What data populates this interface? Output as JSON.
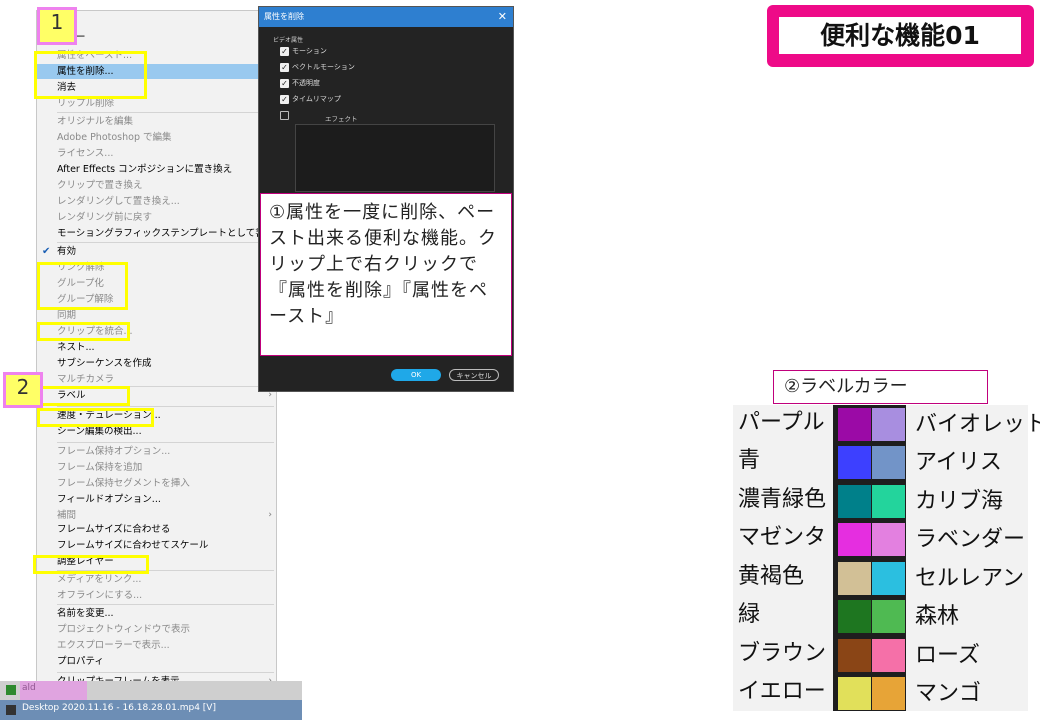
{
  "badges": {
    "one": "1",
    "two": "2"
  },
  "menu": {
    "items": [
      {
        "label": "コピー",
        "state": "normal",
        "top": 0
      },
      {
        "label": "属性をペースト...",
        "state": "dis",
        "top": 0
      },
      {
        "label": "属性を削除...",
        "state": "hl",
        "top": 0
      },
      {
        "label": "消去",
        "state": "normal",
        "top": 0
      },
      {
        "label": "リップル削除",
        "state": "dis",
        "top": 0
      },
      {
        "label": "オリジナルを編集",
        "state": "dis",
        "top": 0
      },
      {
        "label": "Adobe Photoshop で編集",
        "state": "dis",
        "top": 0
      },
      {
        "label": "ライセンス...",
        "state": "dis",
        "top": 0
      },
      {
        "label": "After Effects コンポジションに置き換え",
        "state": "normal",
        "top": 0
      },
      {
        "label": "クリップで置き換え",
        "state": "dis",
        "top": 0
      },
      {
        "label": "レンダリングして置き換え...",
        "state": "dis",
        "top": 0
      },
      {
        "label": "レンダリング前に戻す",
        "state": "dis",
        "top": 0
      },
      {
        "label": "モーショングラフィックステンプレートとして書き出し...",
        "state": "normal",
        "top": 0
      },
      {
        "label": "有効",
        "state": "check",
        "top": 0
      },
      {
        "label": "リンク解除",
        "state": "dis",
        "top": 0
      },
      {
        "label": "グループ化",
        "state": "dis",
        "top": 0
      },
      {
        "label": "グループ解除",
        "state": "dis",
        "top": 0
      },
      {
        "label": "同期",
        "state": "dis",
        "top": 0
      },
      {
        "label": "クリップを統合...",
        "state": "dis",
        "top": 0
      },
      {
        "label": "ネスト...",
        "state": "normal",
        "top": 0
      },
      {
        "label": "サブシーケンスを作成",
        "state": "normal",
        "top": 0
      },
      {
        "label": "マルチカメラ",
        "state": "dis",
        "top": 0
      },
      {
        "label": "ラベル",
        "state": "sub",
        "top": 0
      },
      {
        "label": "速度・デュレーション...",
        "state": "normal",
        "top": 0
      },
      {
        "label": "シーン編集の検出...",
        "state": "normal",
        "top": 0
      },
      {
        "label": "フレーム保持オプション...",
        "state": "dis",
        "top": 0
      },
      {
        "label": "フレーム保持を追加",
        "state": "dis",
        "top": 0
      },
      {
        "label": "フレーム保持セグメントを挿入",
        "state": "dis",
        "top": 0
      },
      {
        "label": "フィールドオプション...",
        "state": "normal",
        "top": 0
      },
      {
        "label": "補間",
        "state": "dissub",
        "top": 0
      },
      {
        "label": "フレームサイズに合わせる",
        "state": "normal",
        "top": 0
      },
      {
        "label": "フレームサイズに合わせてスケール",
        "state": "normal",
        "top": 0
      },
      {
        "label": "調整レイヤー",
        "state": "normal",
        "top": 0
      },
      {
        "label": "メディアをリンク...",
        "state": "dis",
        "top": 0
      },
      {
        "label": "オフラインにする...",
        "state": "dis",
        "top": 0
      },
      {
        "label": "名前を変更...",
        "state": "normal",
        "top": 0
      },
      {
        "label": "プロジェクトウィンドウで表示",
        "state": "dis",
        "top": 0
      },
      {
        "label": "エクスプローラーで表示...",
        "state": "dis",
        "top": 0
      },
      {
        "label": "プロパティ",
        "state": "normal",
        "top": 0
      },
      {
        "label": "クリップキーフレームを表示",
        "state": "sub",
        "top": 0
      }
    ]
  },
  "dialog": {
    "title": "属性を削除",
    "section": "ビデオ属性",
    "checks": [
      "モーション",
      "ベクトルモーション",
      "不透明度",
      "タイムリマップ"
    ],
    "effect_label": "エフェクト",
    "ok": "OK",
    "cancel": "キャンセル"
  },
  "note1": "①属性を一度に削除、ペースト出来る便利な機能。クリップ上で右クリックで『属性を削除』『属性をペースト』",
  "title": "便利な機能01",
  "label_header": "②ラベルカラー",
  "labels": {
    "left": [
      "パープル",
      "青",
      "濃青緑色",
      "マゼンタ",
      "黄褐色",
      "緑",
      "ブラウン",
      "イエロー"
    ],
    "right": [
      "バイオレット",
      "アイリス",
      "カリブ海",
      "ラベンダー",
      "セルレアン",
      "森林",
      "ローズ",
      "マンゴ"
    ],
    "left_colors": [
      "#9b0aa6",
      "#3d40ff",
      "#00808a",
      "#e52ee0",
      "#d2c096",
      "#1e7620",
      "#8a4516",
      "#e1e05a"
    ],
    "right_colors": [
      "#a88ee0",
      "#7294c8",
      "#23d49c",
      "#e380e0",
      "#2bbfe0",
      "#4fba52",
      "#f570a8",
      "#e7a437"
    ]
  },
  "taskbar": {
    "item1": "ald",
    "item2": "Desktop 2020.11.16 - 16.18.28.01.mp4 [V]"
  }
}
